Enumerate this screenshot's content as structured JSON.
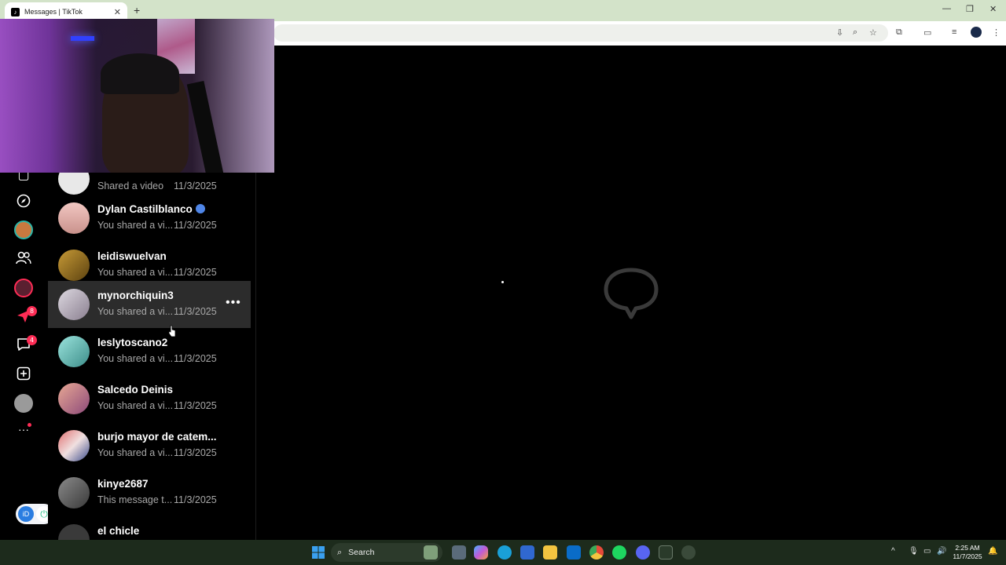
{
  "browser": {
    "tab_title": "Messages | TikTok",
    "tab_close": "✕",
    "new_tab": "+",
    "win_minimize": "—",
    "win_restore": "❐",
    "win_close": "✕"
  },
  "nav": {
    "badge_inbox": "8",
    "badge_messages": "4",
    "more": "···"
  },
  "conversations": [
    {
      "name": "",
      "preview": "Shared a video",
      "date": "11/3/2025",
      "avatar_color": "#e8e8e8"
    },
    {
      "name": "Dylan Castilblanco",
      "verified": true,
      "preview": "You shared a vi...",
      "date": "11/3/2025",
      "avatar_color": "#d8a7a0"
    },
    {
      "name": "leidiswuelvan",
      "preview": "You shared a vi...",
      "date": "11/3/2025",
      "avatar_color": "#8a6a1e"
    },
    {
      "name": "mynorchiquin3",
      "preview": "You shared a vi...",
      "date": "11/3/2025",
      "avatar_color": "#b9b4c0",
      "hovered": true,
      "more": "•••"
    },
    {
      "name": "leslytoscano2",
      "preview": "You shared a vi...",
      "date": "11/3/2025",
      "avatar_color": "#7fc9c4"
    },
    {
      "name": "Salcedo Deinis",
      "preview": "You shared a vi...",
      "date": "11/3/2025",
      "avatar_color": "#d18a7a"
    },
    {
      "name": "burjo mayor de catem...",
      "preview": "You shared a vi...",
      "date": "11/3/2025",
      "avatar_color": "#c65a5a"
    },
    {
      "name": "kinye2687",
      "preview": "This message t...",
      "date": "11/3/2025",
      "avatar_color": "#6a6a6a"
    },
    {
      "name": "el chicle",
      "preview": "",
      "date": "",
      "avatar_color": "#3a3a3a"
    }
  ],
  "taskbar": {
    "search_placeholder": "Search",
    "clock_time": "2:25 AM",
    "clock_date": "11/7/2025",
    "tray_chevron": "^"
  }
}
